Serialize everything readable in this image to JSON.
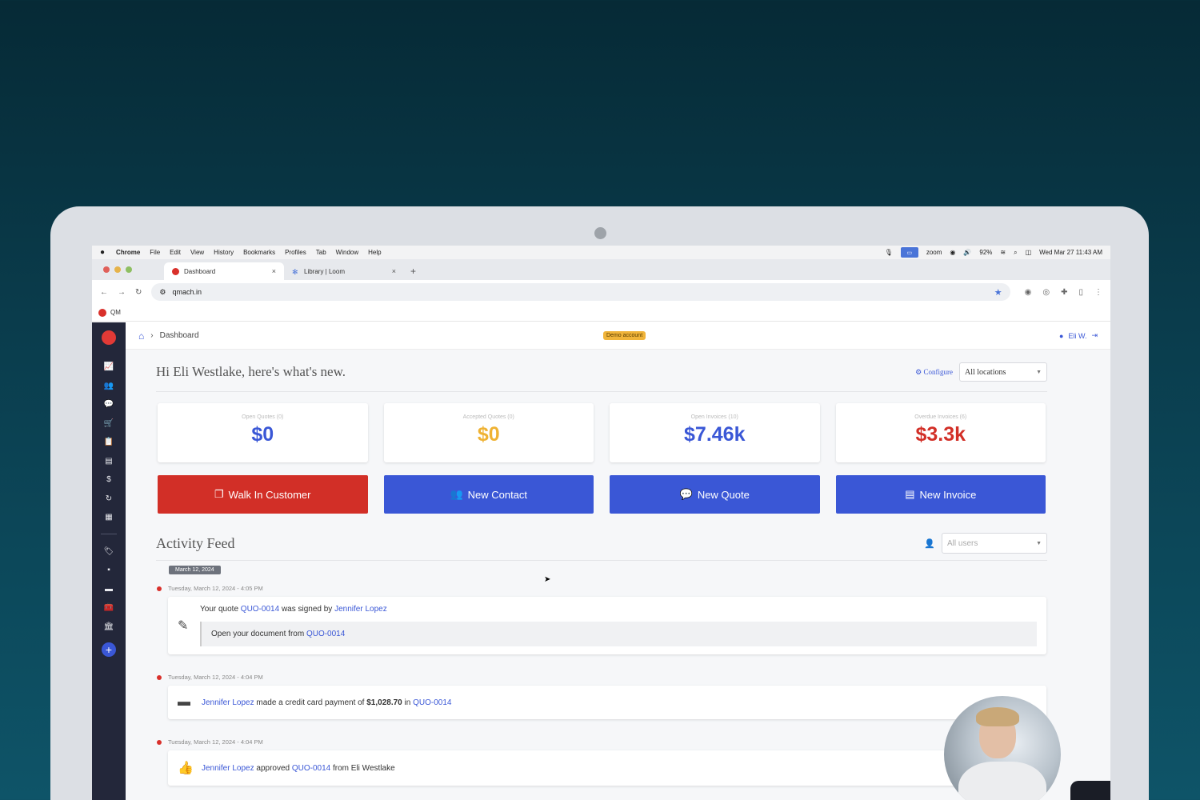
{
  "menubar": {
    "apple": "",
    "items": [
      "Chrome",
      "File",
      "Edit",
      "View",
      "History",
      "Bookmarks",
      "Profiles",
      "Tab",
      "Window",
      "Help"
    ],
    "zoom": "zoom",
    "battery": "92%",
    "datetime": "Wed Mar 27  11:43 AM"
  },
  "browser": {
    "tabs": [
      {
        "title": "Dashboard",
        "active": true
      },
      {
        "title": "Library | Loom",
        "active": false
      }
    ],
    "url": "qmach.in",
    "bookmark": "QM"
  },
  "app": {
    "breadcrumb": "Dashboard",
    "demo_badge": "Demo account",
    "user": "Eli W.",
    "greeting": "Hi Eli Westlake, here's what's new.",
    "configure": "Configure",
    "location_select": "All locations",
    "stats": [
      {
        "label": "Open Quotes (0)",
        "value": "$0",
        "color": "#3a57d6"
      },
      {
        "label": "Accepted Quotes (0)",
        "value": "$0",
        "color": "#efb233"
      },
      {
        "label": "Open Invoices (10)",
        "value": "$7.46k",
        "color": "#3a57d6"
      },
      {
        "label": "Overdue Invoices (6)",
        "value": "$3.3k",
        "color": "#d22f27"
      }
    ],
    "actions": [
      {
        "label": "Walk In Customer",
        "color": "#d22f27",
        "icon": "copy-icon"
      },
      {
        "label": "New Contact",
        "color": "#3a57d6",
        "icon": "users-icon"
      },
      {
        "label": "New Quote",
        "color": "#3a57d6",
        "icon": "comments-dollar-icon"
      },
      {
        "label": "New Invoice",
        "color": "#3a57d6",
        "icon": "invoice-icon"
      }
    ],
    "feed_title": "Activity Feed",
    "users_select": "All users",
    "date_chip": "March 12, 2024",
    "events": [
      {
        "time": "Tuesday, March 12, 2024 - 4:05 PM",
        "pre": "Your quote",
        "quote": "QUO-0014",
        "mid": "was signed by",
        "person": "Jennifer Lopez",
        "sub_pre": "Open your document from",
        "sub_link": "QUO-0014"
      },
      {
        "time": "Tuesday, March 12, 2024 - 4:04 PM",
        "person": "Jennifer Lopez",
        "mid": "made a credit card payment of",
        "amount": "$1,028.70",
        "in": "in",
        "quote": "QUO-0014"
      },
      {
        "time": "Tuesday, March 12, 2024 - 4:04 PM",
        "person": "Jennifer Lopez",
        "mid": "approved",
        "quote": "QUO-0014",
        "post": "from Eli Westlake"
      }
    ]
  }
}
